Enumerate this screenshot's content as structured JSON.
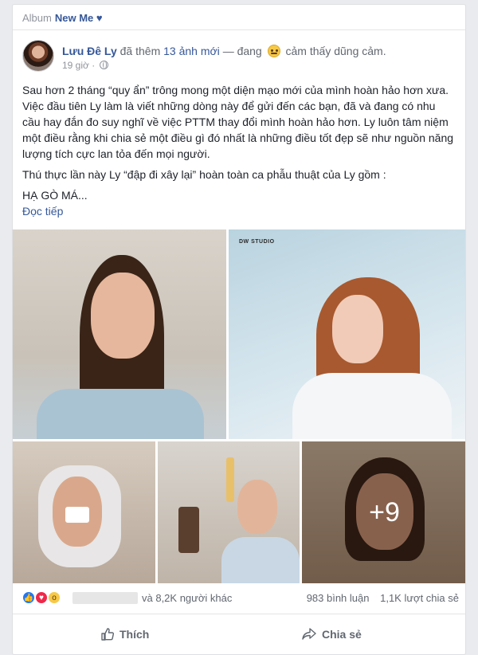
{
  "album": {
    "label": "Album",
    "name": "New Me ♥"
  },
  "post": {
    "author": "Lưu Đê Ly",
    "action": "đã thêm",
    "photo_count_text": "13 ảnh mới",
    "separator": "— đang",
    "feeling_text": "cảm thấy dũng cảm.",
    "time": "19 giờ",
    "privacy_icon": "globe-icon",
    "dot": "·",
    "paragraphs": [
      "Sau hơn 2 tháng “quy ẩn” trông mong một diện mạo mới của mình hoàn hảo hơn xưa. Việc đầu tiên Ly làm là viết những dòng này để gửi đến các bạn, đã và đang có nhu cầu hay đắn đo suy nghĩ về việc PTTM thay đổi mình hoàn hảo hơn. Ly luôn tâm niệm một điều rằng khi chia sẻ một điều gì đó nhất là những điều tốt đẹp sẽ như nguồn năng lượng tích cực lan tỏa đến mọi người.",
      "Thú thực lần này Ly “đập đi xây lại” hoàn toàn ca phẫu thuật của Ly gồm :",
      "HẠ GÒ MÁ..."
    ],
    "read_more": "Đọc tiếp"
  },
  "photos": {
    "brand_mark": "DW STUDIO",
    "more_overlay": "+9"
  },
  "reactions": {
    "icons": [
      "like-reaction-icon",
      "love-reaction-icon",
      "wow-reaction-icon"
    ],
    "others_text": "và 8,2K người khác",
    "comments": "983 bình luận",
    "shares": "1,1K lượt chia sẻ"
  },
  "actions": {
    "like_label": "Thích",
    "share_label": "Chia sẻ"
  },
  "colors": {
    "page_bg": "#e9ebee",
    "link": "#365899",
    "muted": "#90949c",
    "like_blue": "#2078f4",
    "love_red": "#f0284a"
  }
}
